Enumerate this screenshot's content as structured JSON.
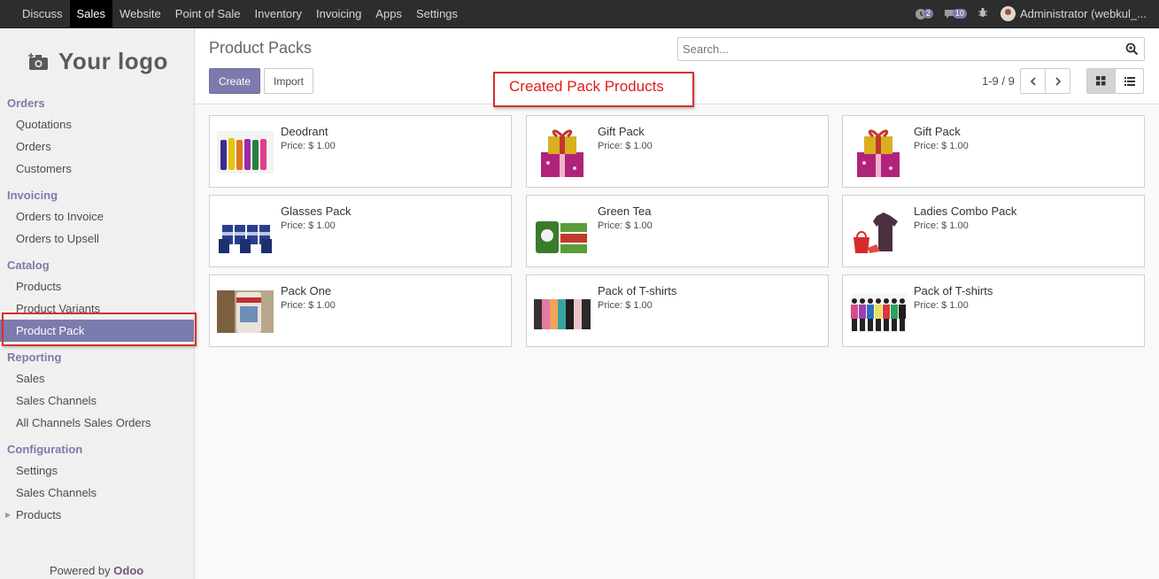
{
  "topbar": {
    "menu": [
      "Discuss",
      "Sales",
      "Website",
      "Point of Sale",
      "Inventory",
      "Invoicing",
      "Apps",
      "Settings"
    ],
    "active": "Sales",
    "messages_count": "2",
    "chat_count": "10",
    "user_name": "Administrator (webkul_..."
  },
  "sidebar": {
    "logo_text": "Your logo",
    "sections": [
      {
        "title": "Orders",
        "items": [
          "Quotations",
          "Orders",
          "Customers"
        ]
      },
      {
        "title": "Invoicing",
        "items": [
          "Orders to Invoice",
          "Orders to Upsell"
        ]
      },
      {
        "title": "Catalog",
        "items": [
          "Products",
          "Product Variants",
          "Product Pack"
        ]
      },
      {
        "title": "Reporting",
        "items": [
          "Sales",
          "Sales Channels",
          "All Channels Sales Orders"
        ]
      },
      {
        "title": "Configuration",
        "items": [
          "Settings",
          "Sales Channels",
          "Products"
        ]
      }
    ],
    "active_item": "Product Pack",
    "powered_by": "Powered by",
    "powered_brand": "Odoo"
  },
  "control_panel": {
    "title": "Product Packs",
    "create_label": "Create",
    "import_label": "Import",
    "search_placeholder": "Search...",
    "pager": "1-9 / 9"
  },
  "annotation": "Created Pack Products",
  "products": [
    {
      "name": "Deodrant",
      "price": "Price: $ 1.00",
      "image": "deodorant-bottles"
    },
    {
      "name": "Gift Pack",
      "price": "Price: $ 1.00",
      "image": "gift-boxes"
    },
    {
      "name": "Gift Pack",
      "price": "Price: $ 1.00",
      "image": "gift-boxes"
    },
    {
      "name": "Glasses Pack",
      "price": "Price: $ 1.00",
      "image": "glasses"
    },
    {
      "name": "Green Tea",
      "price": "Price: $ 1.00",
      "image": "green-tea-boxes"
    },
    {
      "name": "Ladies Combo Pack",
      "price": "Price: $ 1.00",
      "image": "ladies-combo"
    },
    {
      "name": "Pack One",
      "price": "Price: $ 1.00",
      "image": "can-pack"
    },
    {
      "name": "Pack of T-shirts",
      "price": "Price: $ 1.00",
      "image": "tshirts-color"
    },
    {
      "name": "Pack of T-shirts",
      "price": "Price: $ 1.00",
      "image": "tshirts-models"
    }
  ]
}
